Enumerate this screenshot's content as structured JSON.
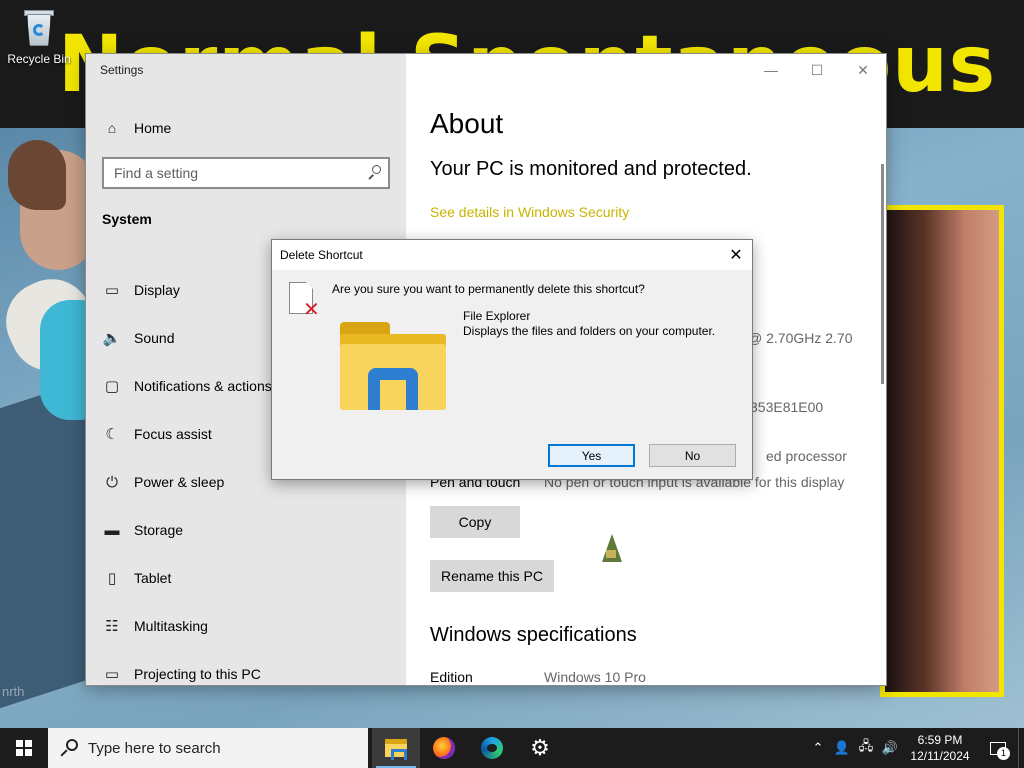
{
  "desktop": {
    "wallpaper_title": "Normal Spontaneous Vaginal Delivery",
    "watermark": "nrth",
    "recycle_bin_label": "Recycle Bin"
  },
  "settings": {
    "window_title": "Settings",
    "nav": {
      "home": "Home",
      "search_placeholder": "Find a setting",
      "section": "System",
      "items": [
        {
          "label": "Display",
          "icon": "display-icon",
          "glyph": "▭"
        },
        {
          "label": "Sound",
          "icon": "sound-icon",
          "glyph": "🔈"
        },
        {
          "label": "Notifications & actions",
          "icon": "notifications-icon",
          "glyph": "▢"
        },
        {
          "label": "Focus assist",
          "icon": "moon-icon",
          "glyph": "☾"
        },
        {
          "label": "Power & sleep",
          "icon": "power-icon",
          "glyph": "⏻"
        },
        {
          "label": "Storage",
          "icon": "storage-icon",
          "glyph": "▬"
        },
        {
          "label": "Tablet",
          "icon": "tablet-icon",
          "glyph": "▯"
        },
        {
          "label": "Multitasking",
          "icon": "multitasking-icon",
          "glyph": "☷"
        },
        {
          "label": "Projecting to this PC",
          "icon": "projecting-icon",
          "glyph": "▭"
        }
      ]
    },
    "main": {
      "title": "About",
      "protection_text": "Your PC is monitored and protected.",
      "security_link": "See details in Windows Security",
      "processor_fragment": "@ 2.70GHz   2.70",
      "device_id_fragment": "353E81E00",
      "system_type_fragment": "ed processor",
      "pen_touch_label": "Pen and touch",
      "pen_touch_value": "No pen or touch input is available for this display",
      "copy_button": "Copy",
      "rename_button": "Rename this PC",
      "windows_spec_title": "Windows specifications",
      "edition_label": "Edition",
      "edition_value": "Windows 10 Pro"
    },
    "window_controls": {
      "minimize": "—",
      "maximize": "☐",
      "close": "✕"
    }
  },
  "dialog": {
    "title": "Delete Shortcut",
    "close": "✕",
    "question": "Are you sure you want to permanently delete this shortcut?",
    "file_name": "File Explorer",
    "file_description": "Displays the files and folders on your computer.",
    "yes_button": "Yes",
    "no_button": "No"
  },
  "taskbar": {
    "search_placeholder": "Type here to search",
    "apps": [
      {
        "name": "file-explorer",
        "active": true
      },
      {
        "name": "firefox",
        "active": false
      },
      {
        "name": "edge",
        "active": false
      },
      {
        "name": "settings",
        "active": false
      }
    ],
    "time": "6:59 PM",
    "date": "12/11/2024",
    "notification_count": "1"
  },
  "colors": {
    "accent": "#0078d7",
    "link": "#c8b400",
    "wallpaper_title": "#f2e600",
    "taskbar": "#1c1c1c"
  }
}
